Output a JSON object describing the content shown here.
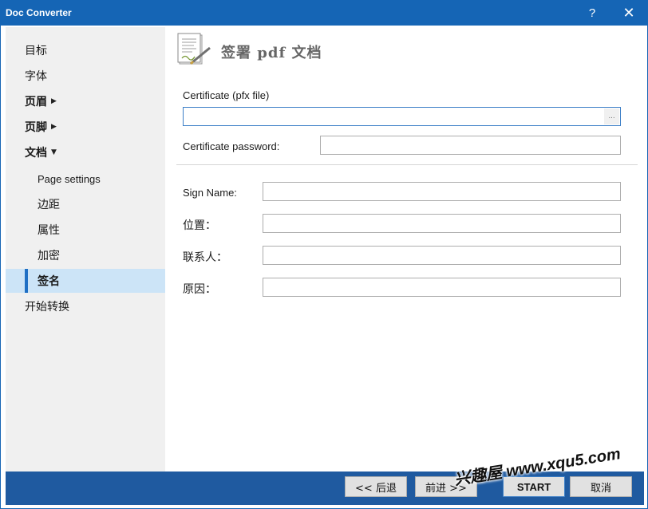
{
  "window": {
    "title": "Doc Converter",
    "help_label": "?",
    "close_label": "✕"
  },
  "sidebar": {
    "items": [
      {
        "label": "目标"
      },
      {
        "label": "字体"
      },
      {
        "label": "页眉"
      },
      {
        "label": "页脚"
      },
      {
        "label": "文档"
      },
      {
        "label": "Page settings"
      },
      {
        "label": "边距"
      },
      {
        "label": "属性"
      },
      {
        "label": "加密"
      },
      {
        "label": "签名"
      },
      {
        "label": "开始转换"
      }
    ]
  },
  "main": {
    "title": "签署 pdf 文档",
    "certificate": {
      "label": "Certificate (pfx file)",
      "value": "",
      "browse_label": "..."
    },
    "password": {
      "label": "Certificate password:",
      "value": ""
    },
    "sign_name": {
      "label": "Sign Name:",
      "value": ""
    },
    "location": {
      "label": "位置：",
      "value": ""
    },
    "contact": {
      "label": "联系人：",
      "value": ""
    },
    "reason": {
      "label": "原因：",
      "value": ""
    }
  },
  "footer": {
    "back_label": "<< 后退",
    "next_label": "前进 >>",
    "start_label": "START",
    "cancel_label": "取消"
  },
  "watermark": {
    "text": "兴趣屋 www.xqu5.com"
  },
  "colors": {
    "titlebar": "#1565b5",
    "bottombar": "#1f5aa0",
    "sidebar": "#f0f0f0",
    "active_item": "#cce4f7",
    "accent": "#1f6fc4"
  },
  "icons": {
    "page": "signed-document-icon",
    "expand": "caret-right-icon",
    "collapse": "caret-down-icon"
  }
}
